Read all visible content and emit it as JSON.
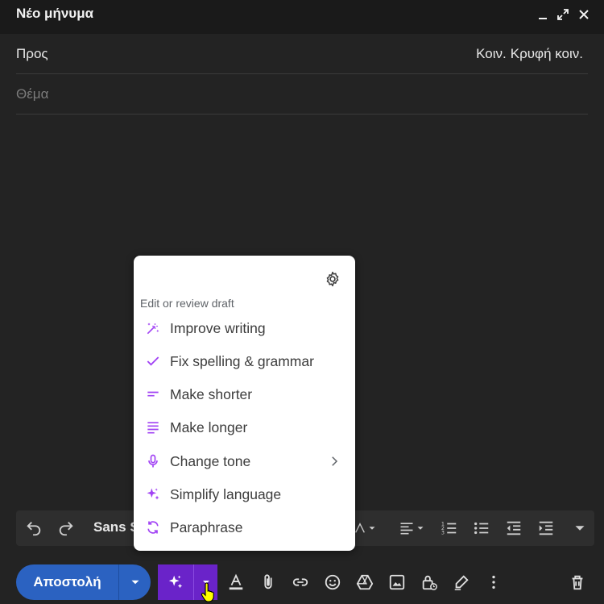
{
  "window": {
    "title": "Νέο μήνυμα"
  },
  "compose": {
    "to_label": "Προς",
    "cc_label": "Κοιν.",
    "bcc_label": "Κρυφή κοιν.",
    "subject_placeholder": "Θέμα"
  },
  "format_bar": {
    "font_name": "Sans S"
  },
  "send": {
    "label": "Αποστολή"
  },
  "ai_menu": {
    "header": "Edit or review draft",
    "items": [
      {
        "label": "Improve writing",
        "icon": "magic-wand-icon"
      },
      {
        "label": "Fix spelling & grammar",
        "icon": "check-icon"
      },
      {
        "label": "Make shorter",
        "icon": "short-lines-icon"
      },
      {
        "label": "Make longer",
        "icon": "long-lines-icon"
      },
      {
        "label": "Change tone",
        "icon": "microphone-icon"
      },
      {
        "label": "Simplify language",
        "icon": "sparkle-icon"
      },
      {
        "label": "Paraphrase",
        "icon": "refresh-icon"
      }
    ]
  },
  "colors": {
    "send_button": "#2b62c1",
    "ai_button": "#6a23c9",
    "menu_icon": "#a142f4",
    "background": "#232323"
  }
}
